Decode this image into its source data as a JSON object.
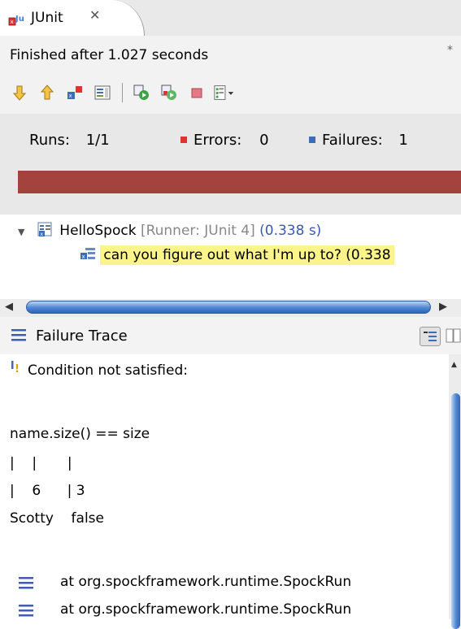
{
  "tab": {
    "label": "JUnit",
    "close_glyph": "✕"
  },
  "status": {
    "text": "Finished after 1.027 seconds",
    "mark": "*"
  },
  "toolbar": {
    "icons": [
      "next-failure-icon",
      "previous-failure-icon",
      "failures-only-icon",
      "scroll-lock-icon",
      "rerun-icon",
      "rerun-failed-icon",
      "stop-icon",
      "history-dropdown-icon"
    ]
  },
  "counters": {
    "runs_label": "Runs:",
    "runs_value": "1/1",
    "errors_label": "Errors:",
    "errors_value": "0",
    "failures_label": "Failures:",
    "failures_value": "1",
    "progress_fraction": 1.0,
    "progress_color": "#a4433e"
  },
  "tree": {
    "suite_name": "HelloSpock",
    "suite_runner": "[Runner: JUnit 4]",
    "suite_time": "(0.338 s)",
    "test_name": "can you figure out what I'm up to?",
    "test_time": "(0.338"
  },
  "failure_trace": {
    "title": "Failure Trace",
    "message": "Condition not satisfied:",
    "lines": [
      "name.size() == size",
      "|    |       |",
      "|    6      | 3",
      "Scotty    false"
    ],
    "stack": [
      "at org.spockframework.runtime.SpockRun",
      "at org.spockframework.runtime.SpockRun"
    ]
  }
}
